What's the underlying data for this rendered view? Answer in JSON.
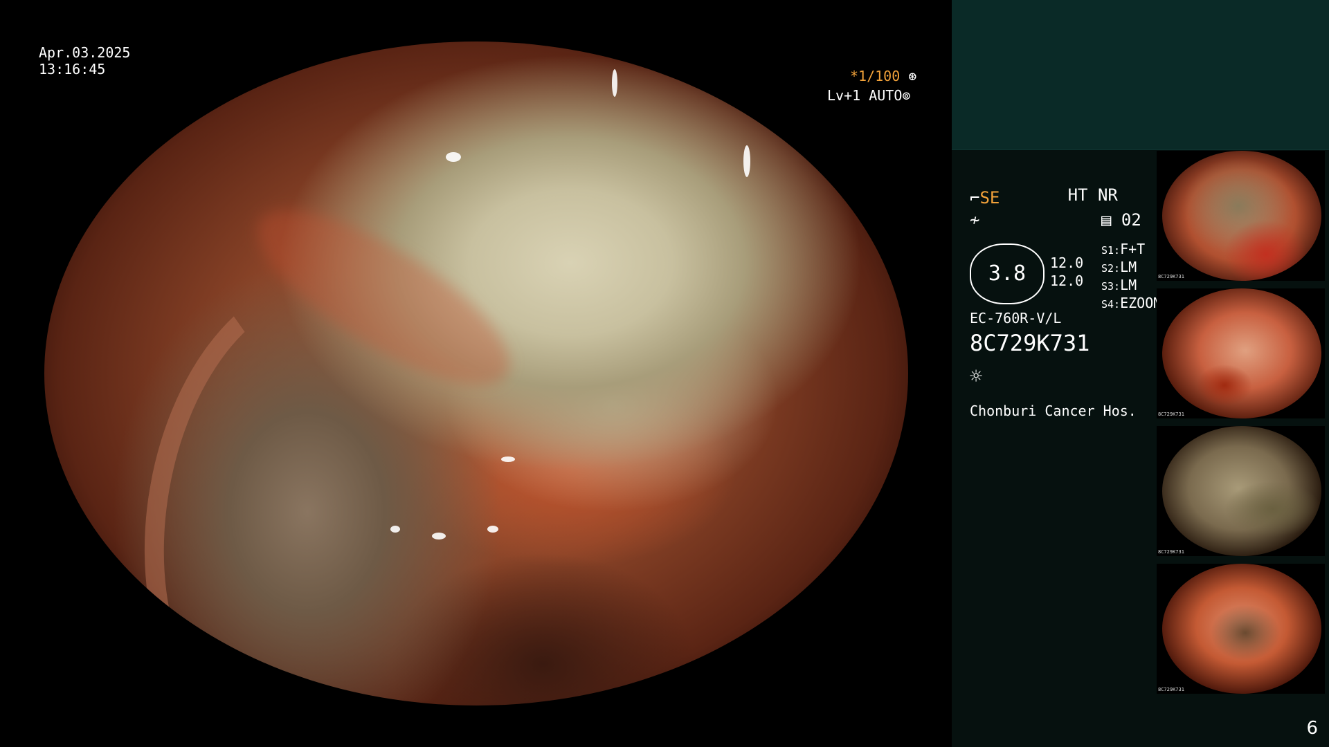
{
  "header": {
    "date": "Apr.03.2025",
    "time": "13:16:45"
  },
  "scope_status": {
    "shutter": "*1/100",
    "shutter_icon": "aperture-icon",
    "level": "Lv+1 AUTO",
    "level_icon": "iris-icon"
  },
  "processing": {
    "line1": "HT NR",
    "mode": "SE",
    "mode_icon": "enhance-icon",
    "mode_color": "#f2a23a",
    "freeze_icon": "freeze-icon",
    "memory_label": "02",
    "memory_icon": "memory-icon"
  },
  "gauge": {
    "value": "3.8",
    "upper": "12.0",
    "lower": "12.0"
  },
  "switches": [
    {
      "key": "S1:",
      "value": "F+T"
    },
    {
      "key": "S2:",
      "value": "LM"
    },
    {
      "key": "S3:",
      "value": "LM"
    },
    {
      "key": "S4:",
      "value": "EZOOM"
    }
  ],
  "scope_model": "EC-760R-V/L",
  "scope_serial": "8C729K731",
  "light_icon": "light-source-icon",
  "hospital": "Chonburi Cancer Hos.",
  "page_number": "6",
  "thumbnails": [
    {
      "serial": "8C729K731"
    },
    {
      "serial": "8C729K731"
    },
    {
      "serial": "8C729K731"
    },
    {
      "serial": "8C729K731"
    }
  ]
}
